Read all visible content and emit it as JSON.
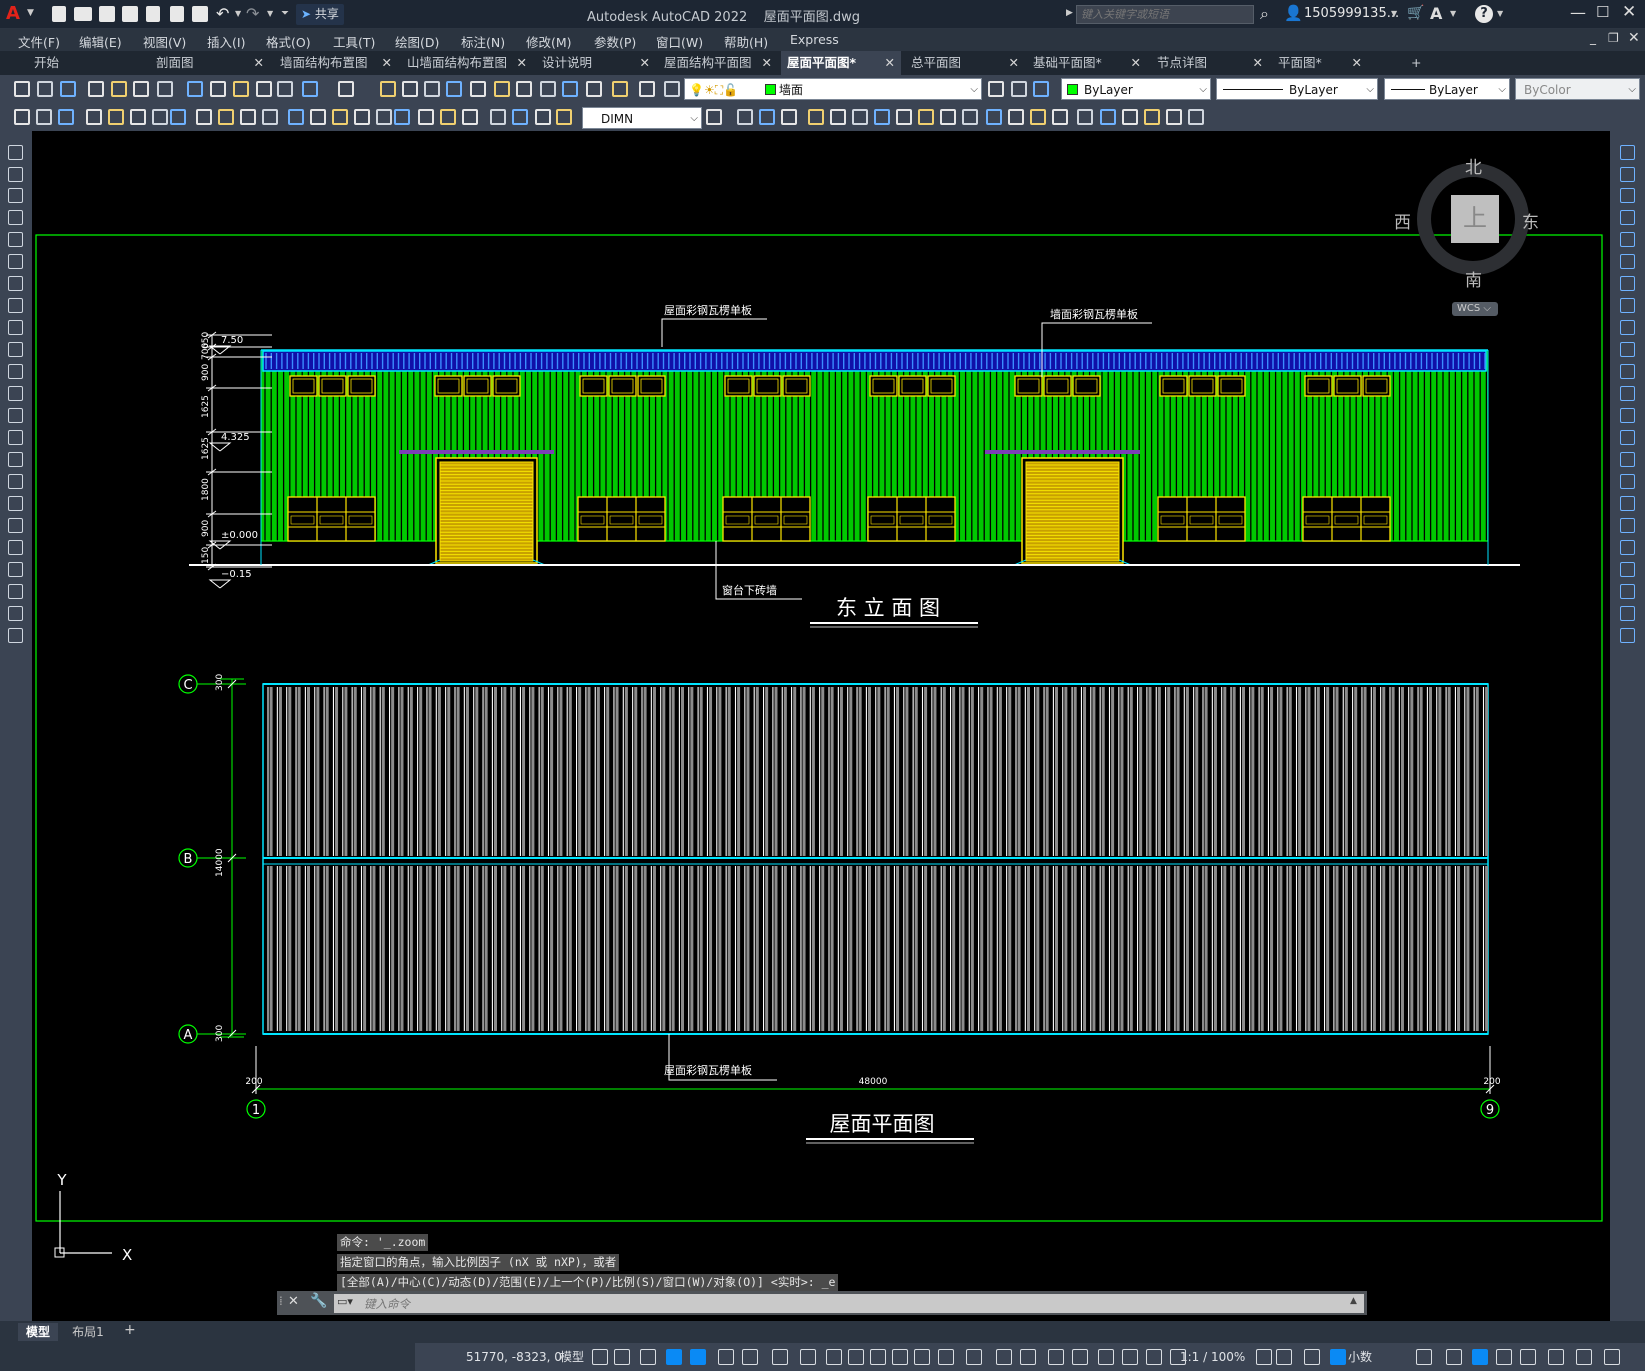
{
  "app": {
    "title": "Autodesk AutoCAD 2022",
    "filename": "屋面平面图.dwg",
    "logo_letter": "A",
    "share_label": "共享",
    "search_placeholder": "键入关键字或短语",
    "user": "1505999135...",
    "help": "?"
  },
  "menu": [
    "文件(F)",
    "编辑(E)",
    "视图(V)",
    "插入(I)",
    "格式(O)",
    "工具(T)",
    "绘图(D)",
    "标注(N)",
    "修改(M)",
    "参数(P)",
    "窗口(W)",
    "帮助(H)",
    "Express"
  ],
  "tabs": [
    {
      "label": "开始",
      "active": false,
      "closable": false
    },
    {
      "label": "剖面图",
      "active": false,
      "closable": true
    },
    {
      "label": "墙面结构布置图",
      "active": false,
      "closable": true
    },
    {
      "label": "山墙面结构布置图",
      "active": false,
      "closable": true
    },
    {
      "label": "设计说明",
      "active": false,
      "closable": true
    },
    {
      "label": "屋面结构平面图",
      "active": false,
      "closable": true
    },
    {
      "label": "屋面平面图*",
      "active": true,
      "closable": true
    },
    {
      "label": "总平面图",
      "active": false,
      "closable": true
    },
    {
      "label": "基础平面图*",
      "active": false,
      "closable": true
    },
    {
      "label": "节点详图",
      "active": false,
      "closable": true
    },
    {
      "label": "平面图*",
      "active": false,
      "closable": true
    }
  ],
  "tab_add": "+",
  "properties": {
    "layer": "墙面",
    "color": "ByLayer",
    "linetype": "ByLayer",
    "lineweight": "ByLayer",
    "plotstyle": "ByColor",
    "dimstyle": "DIMN"
  },
  "viewcube": {
    "north": "北",
    "south": "南",
    "east": "东",
    "west": "西",
    "top": "上",
    "wcs": "WCS"
  },
  "drawing": {
    "elev_labels": {
      "roof_panel": "屋面彩钢瓦楞单板",
      "wall_panel": "墙面彩钢瓦楞单板",
      "brick": "窗台下砖墙",
      "title": "东 立 面 图"
    },
    "elev_dims": [
      "650",
      "700",
      "900",
      "1625",
      "1625",
      "1800",
      "900",
      "150"
    ],
    "elev_levels": [
      "7.50",
      "4.325",
      "±0.000",
      "−0.15"
    ],
    "plan_labels": {
      "roof_panel": "屋面彩钢瓦楞单板",
      "title": "屋面平面图"
    },
    "plan_axes": [
      "C",
      "B",
      "A"
    ],
    "plan_vdims": [
      "300",
      "14000",
      "300"
    ],
    "plan_hdims": [
      "200",
      "48000",
      "200"
    ],
    "plan_grid": [
      "1",
      "9"
    ]
  },
  "ucs": {
    "x": "X",
    "y": "Y"
  },
  "command": {
    "history": [
      "命令: '_.zoom",
      "指定窗口的角点，输入比例因子 (nX 或 nXP)，或者",
      "[全部(A)/中心(C)/动态(D)/范围(E)/上一个(P)/比例(S)/窗口(W)/对象(O)] <实时>: _e"
    ],
    "placeholder": "键入命令"
  },
  "layout_tabs": [
    "模型",
    "布局1"
  ],
  "layout_add": "+",
  "status": {
    "coords": "51770, -8323, 0",
    "space": "模型",
    "scale": "1:1 / 100%",
    "units": "小数"
  },
  "colors": {
    "accent": "#0a8af5",
    "drawing_green": "#00ff00",
    "cyan": "#00e5ff",
    "yellow": "#ffe500",
    "blue_roof": "#2020ff"
  }
}
